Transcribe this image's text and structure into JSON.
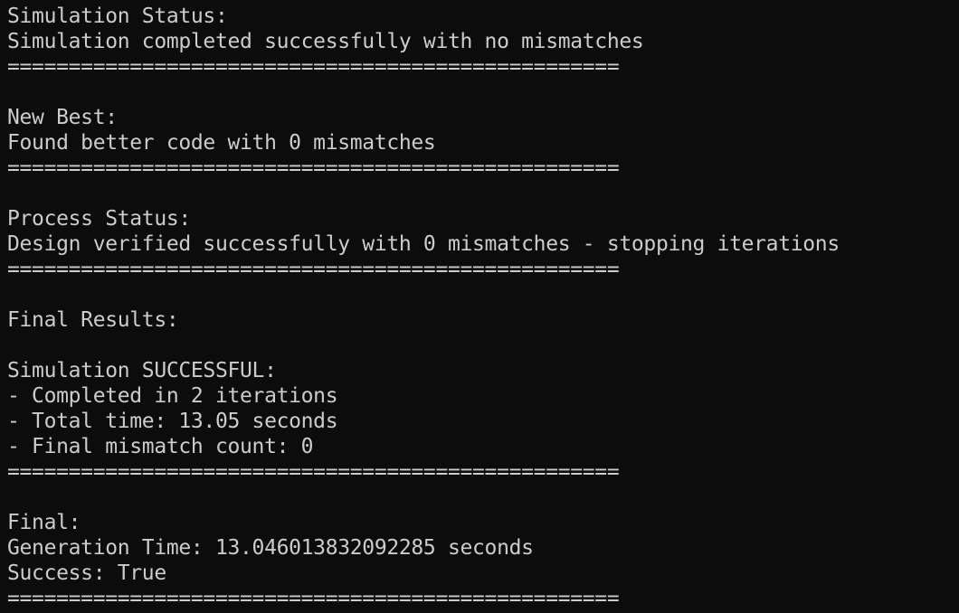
{
  "terminal": {
    "background_color": "#0c0c0c",
    "text_color": "#cccccc",
    "lines": [
      "Simulation Status:",
      "Simulation completed successfully with no mismatches",
      "==================================================",
      "",
      "New Best:",
      "Found better code with 0 mismatches",
      "==================================================",
      "",
      "Process Status:",
      "Design verified successfully with 0 mismatches - stopping iterations",
      "==================================================",
      "",
      "Final Results:",
      "",
      "Simulation SUCCESSFUL:",
      "- Completed in 2 iterations",
      "- Total time: 13.05 seconds",
      "- Final mismatch count: 0",
      "==================================================",
      "",
      "Final:",
      "Generation Time: 13.046013832092285 seconds",
      "Success: True",
      "=================================================="
    ]
  }
}
